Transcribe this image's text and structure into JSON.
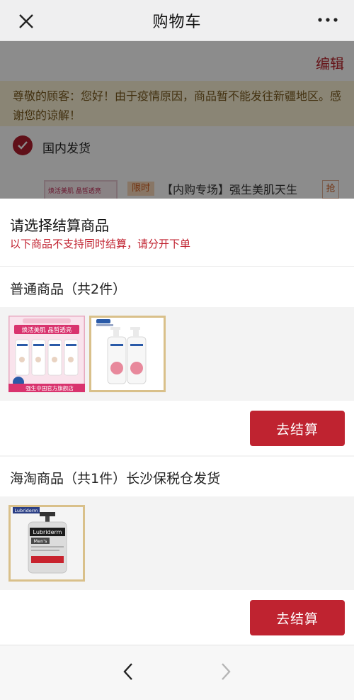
{
  "header": {
    "title": "购物车"
  },
  "background_page": {
    "edit_label": "编辑",
    "notice": "尊敬的顾客：您好！由于疫情原因，商品暂不能发往新疆地区。感谢您的谅解！",
    "region_label": "国内发货",
    "promo_tag": "限时",
    "product_name": "【内购专场】强生美肌天生",
    "grab_label": "抢",
    "thumb_caption": "焕活美肌 晶皙透亮"
  },
  "sheet": {
    "title": "请选择结算商品",
    "subtitle": "以下商品不支持同时结算，请分开下单",
    "groups": [
      {
        "title": "普通商品（共2件）",
        "checkout_label": "去结算",
        "items": [
          {
            "image": "johnson-body-lotion-4-pack",
            "caption_top": "焕活美肌 晶皙透亮",
            "caption_bottom": "强生中国官方旗舰店"
          },
          {
            "image": "johnson-body-wash-2-bottles"
          }
        ]
      },
      {
        "title": "海淘商品（共1件）长沙保税仓发货",
        "checkout_label": "去结算",
        "items": [
          {
            "image": "lubriderm-mens-lotion",
            "brand": "Lubriderm",
            "line": "Men's"
          }
        ]
      }
    ]
  },
  "colors": {
    "accent": "#bf2330",
    "sheet_sub": "#c0202e",
    "notice_bg": "#fbf3d5"
  },
  "icons": {
    "close": "close-icon",
    "more": "more-icon",
    "back": "chevron-left-icon",
    "forward": "chevron-right-icon"
  }
}
